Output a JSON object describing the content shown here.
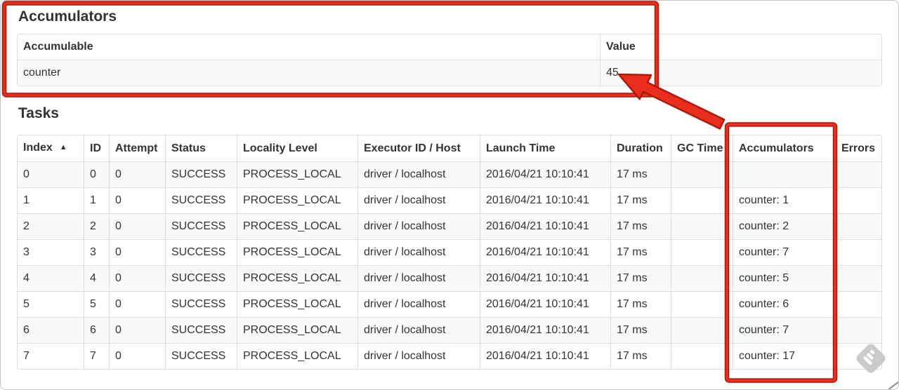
{
  "colors": {
    "annotation_red": "#ea2d1c",
    "annotation_red_dark": "#ab1a0a",
    "table_border": "#dddddd",
    "row_stripe": "#f9f9f9",
    "text": "#333333",
    "watermark_gray": "#c7c7c7",
    "artifact_gray": "#9a9a9a"
  },
  "accumulators_section": {
    "title": "Accumulators",
    "table": {
      "headers": [
        "Accumulable",
        "Value"
      ],
      "rows": [
        [
          "counter",
          "45"
        ]
      ]
    }
  },
  "tasks_section": {
    "title": "Tasks",
    "sorted_column": 0,
    "sort_icon": "▲",
    "table": {
      "headers": [
        "Index",
        "ID",
        "Attempt",
        "Status",
        "Locality Level",
        "Executor ID / Host",
        "Launch Time",
        "Duration",
        "GC Time",
        "Accumulators",
        "Errors"
      ],
      "rows": [
        [
          "0",
          "0",
          "0",
          "SUCCESS",
          "PROCESS_LOCAL",
          "driver / localhost",
          "2016/04/21 10:10:41",
          "17 ms",
          "",
          "",
          ""
        ],
        [
          "1",
          "1",
          "0",
          "SUCCESS",
          "PROCESS_LOCAL",
          "driver / localhost",
          "2016/04/21 10:10:41",
          "17 ms",
          "",
          "counter: 1",
          ""
        ],
        [
          "2",
          "2",
          "0",
          "SUCCESS",
          "PROCESS_LOCAL",
          "driver / localhost",
          "2016/04/21 10:10:41",
          "17 ms",
          "",
          "counter: 2",
          ""
        ],
        [
          "3",
          "3",
          "0",
          "SUCCESS",
          "PROCESS_LOCAL",
          "driver / localhost",
          "2016/04/21 10:10:41",
          "17 ms",
          "",
          "counter: 7",
          ""
        ],
        [
          "4",
          "4",
          "0",
          "SUCCESS",
          "PROCESS_LOCAL",
          "driver / localhost",
          "2016/04/21 10:10:41",
          "17 ms",
          "",
          "counter: 5",
          ""
        ],
        [
          "5",
          "5",
          "0",
          "SUCCESS",
          "PROCESS_LOCAL",
          "driver / localhost",
          "2016/04/21 10:10:41",
          "17 ms",
          "",
          "counter: 6",
          ""
        ],
        [
          "6",
          "6",
          "0",
          "SUCCESS",
          "PROCESS_LOCAL",
          "driver / localhost",
          "2016/04/21 10:10:41",
          "17 ms",
          "",
          "counter: 7",
          ""
        ],
        [
          "7",
          "7",
          "0",
          "SUCCESS",
          "PROCESS_LOCAL",
          "driver / localhost",
          "2016/04/21 10:10:41",
          "17 ms",
          "",
          "counter: 17",
          ""
        ]
      ]
    }
  },
  "annotations": {
    "box_accumulators_section": "highlight around Accumulators summary table",
    "box_accumulators_column": "highlight around Accumulators task column",
    "arrow": "arrow from Accumulators column to total value 45"
  }
}
